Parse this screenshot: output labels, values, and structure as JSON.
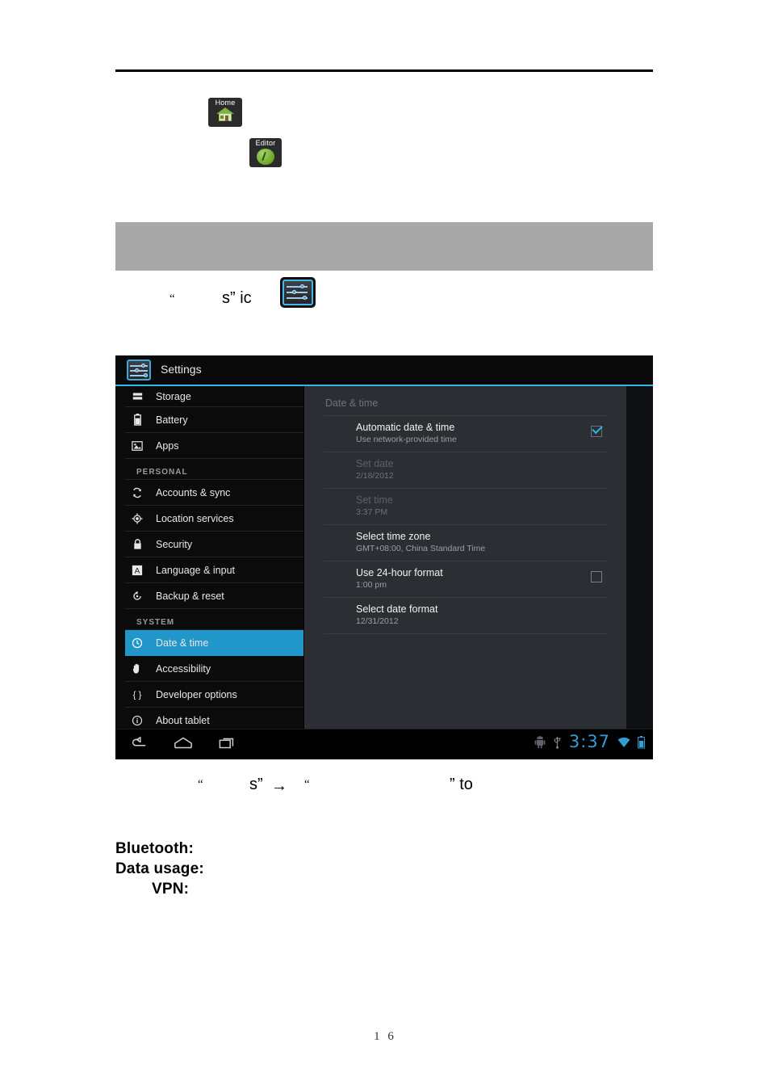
{
  "document": {
    "page_number": "1 6",
    "app_icons": [
      {
        "caption": "Home",
        "icon": "house-icon"
      },
      {
        "caption": "Editor",
        "icon": "editor-icon"
      }
    ],
    "fragments": {
      "quote_open_1": "“",
      "s_ic": "s” ic",
      "quote_open_2": "“",
      "s_close_2": "s”",
      "arrow": "→",
      "quote_open_3": "“",
      "close_to": "” to"
    },
    "bold_labels": [
      "Bluetooth:",
      "Data usage:",
      "VPN:"
    ]
  },
  "tablet": {
    "titlebar": {
      "title": "Settings",
      "icon": "settings-sliders-icon"
    },
    "sidebar": {
      "items": [
        {
          "label": "Storage",
          "icon": "storage-icon",
          "selected": false,
          "partial": true
        },
        {
          "label": "Battery",
          "icon": "battery-icon",
          "selected": false
        },
        {
          "label": "Apps",
          "icon": "apps-icon",
          "selected": false
        },
        {
          "header": "PERSONAL"
        },
        {
          "label": "Accounts & sync",
          "icon": "sync-icon",
          "selected": false
        },
        {
          "label": "Location services",
          "icon": "location-icon",
          "selected": false
        },
        {
          "label": "Security",
          "icon": "lock-icon",
          "selected": false
        },
        {
          "label": "Language & input",
          "icon": "language-a-icon",
          "selected": false
        },
        {
          "label": "Backup & reset",
          "icon": "backup-reset-icon",
          "selected": false
        },
        {
          "header": "SYSTEM"
        },
        {
          "label": "Date & time",
          "icon": "clock-icon",
          "selected": true
        },
        {
          "label": "Accessibility",
          "icon": "hand-icon",
          "selected": false
        },
        {
          "label": "Developer options",
          "icon": "braces-icon",
          "selected": false
        },
        {
          "label": "About tablet",
          "icon": "info-icon",
          "selected": false
        }
      ]
    },
    "content": {
      "panel_title": "Date & time",
      "preferences": [
        {
          "title": "Automatic date & time",
          "subtitle": "Use network-provided time",
          "checkbox": "checked",
          "disabled": false
        },
        {
          "title": "Set date",
          "subtitle": "2/18/2012",
          "checkbox": "none",
          "disabled": true
        },
        {
          "title": "Set time",
          "subtitle": "3:37 PM",
          "checkbox": "none",
          "disabled": true
        },
        {
          "title": "Select time zone",
          "subtitle": "GMT+08:00, China Standard Time",
          "checkbox": "none",
          "disabled": false
        },
        {
          "title": "Use 24-hour format",
          "subtitle": "1:00 pm",
          "checkbox": "unchecked",
          "disabled": false
        },
        {
          "title": "Select date format",
          "subtitle": "12/31/2012",
          "checkbox": "none",
          "disabled": false
        }
      ]
    },
    "navbar": {
      "back": "back-icon",
      "home": "home-icon",
      "recents": "recents-icon",
      "status": {
        "android": "android-robot-icon",
        "usb": "usb-icon",
        "clock": "3:37",
        "wifi": "wifi-icon",
        "battery": "battery-icon"
      }
    }
  },
  "colors": {
    "accent_blue": "#33b5e5",
    "selected_row": "#2196c9",
    "clock_blue": "#2f9fd4",
    "banner_gray": "#a8a8a8"
  }
}
